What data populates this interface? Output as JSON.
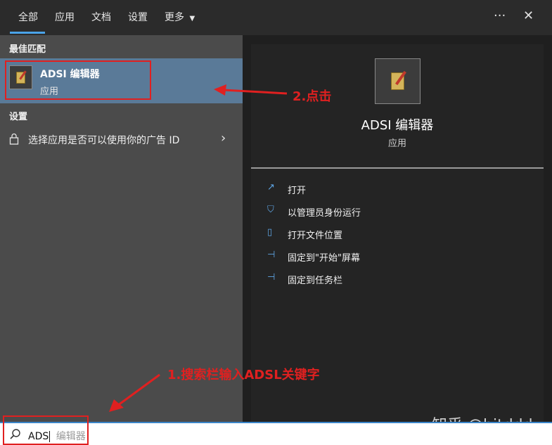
{
  "header": {
    "tabs": [
      "全部",
      "应用",
      "文档",
      "设置",
      "更多"
    ],
    "more_menu_chevron": "chevron-down-icon",
    "ellipsis": "···",
    "close": "✕"
  },
  "left_pane": {
    "best_match_title": "最佳匹配",
    "best_match": {
      "name": "ADSI 编辑器",
      "type": "应用"
    },
    "settings_title": "设置",
    "settings_item": {
      "label": "选择应用是否可以使用你的广告 ID"
    }
  },
  "detail": {
    "name": "ADSI 编辑器",
    "type": "应用",
    "actions": [
      {
        "label": "打开",
        "icon": "open-icon"
      },
      {
        "label": "以管理员身份运行",
        "icon": "shield-icon"
      },
      {
        "label": "打开文件位置",
        "icon": "file-location-icon"
      },
      {
        "label": "固定到\"开始\"屏幕",
        "icon": "pin-icon"
      },
      {
        "label": "固定到任务栏",
        "icon": "pin-icon"
      }
    ]
  },
  "search": {
    "value": "ADS",
    "suggestion": "编辑器"
  },
  "annotations": {
    "step1": "1.搜索栏输入ADSL关键字",
    "step2": "2.点击",
    "color": "#e02020"
  },
  "watermark": "知乎 @bitddd",
  "colors": {
    "accent": "#4aa3e8",
    "selected": "#5a7a98"
  }
}
